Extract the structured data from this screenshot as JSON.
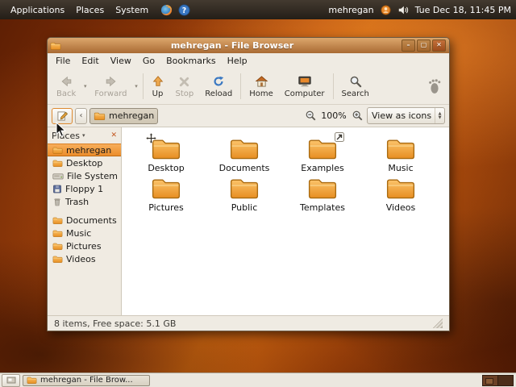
{
  "panel": {
    "menus": [
      "Applications",
      "Places",
      "System"
    ],
    "user": "mehregan",
    "clock": "Tue Dec 18, 11:45 PM"
  },
  "window": {
    "title": "mehregan - File Browser",
    "menubar": [
      "File",
      "Edit",
      "View",
      "Go",
      "Bookmarks",
      "Help"
    ],
    "toolbar": {
      "back": "Back",
      "forward": "Forward",
      "up": "Up",
      "stop": "Stop",
      "reload": "Reload",
      "home": "Home",
      "computer": "Computer",
      "search": "Search"
    },
    "location": {
      "breadcrumb": "mehregan",
      "zoom": "100%",
      "view_mode": "View as icons"
    },
    "places": {
      "header": "Places",
      "items": [
        "mehregan",
        "Desktop",
        "File System",
        "Floppy 1",
        "Trash",
        "Documents",
        "Music",
        "Pictures",
        "Videos"
      ]
    },
    "files": [
      "Desktop",
      "Documents",
      "Examples",
      "Music",
      "Pictures",
      "Public",
      "Templates",
      "Videos"
    ],
    "statusbar": "8 items, Free space: 5.1 GB"
  },
  "taskbar": {
    "window_button": "mehregan - File Brow..."
  },
  "glyphs": {
    "dropdown": "▾",
    "left_scroll": "‹",
    "close_sidebar": "✕",
    "minimize": "–",
    "maximize": "▢",
    "close_win": "✕",
    "stepper_up": "▲",
    "stepper_down": "▼"
  },
  "colors": {
    "accent_orange": "#ec8d2b",
    "titlebar": "#b5793f",
    "panel_dark": "#2e2720"
  }
}
